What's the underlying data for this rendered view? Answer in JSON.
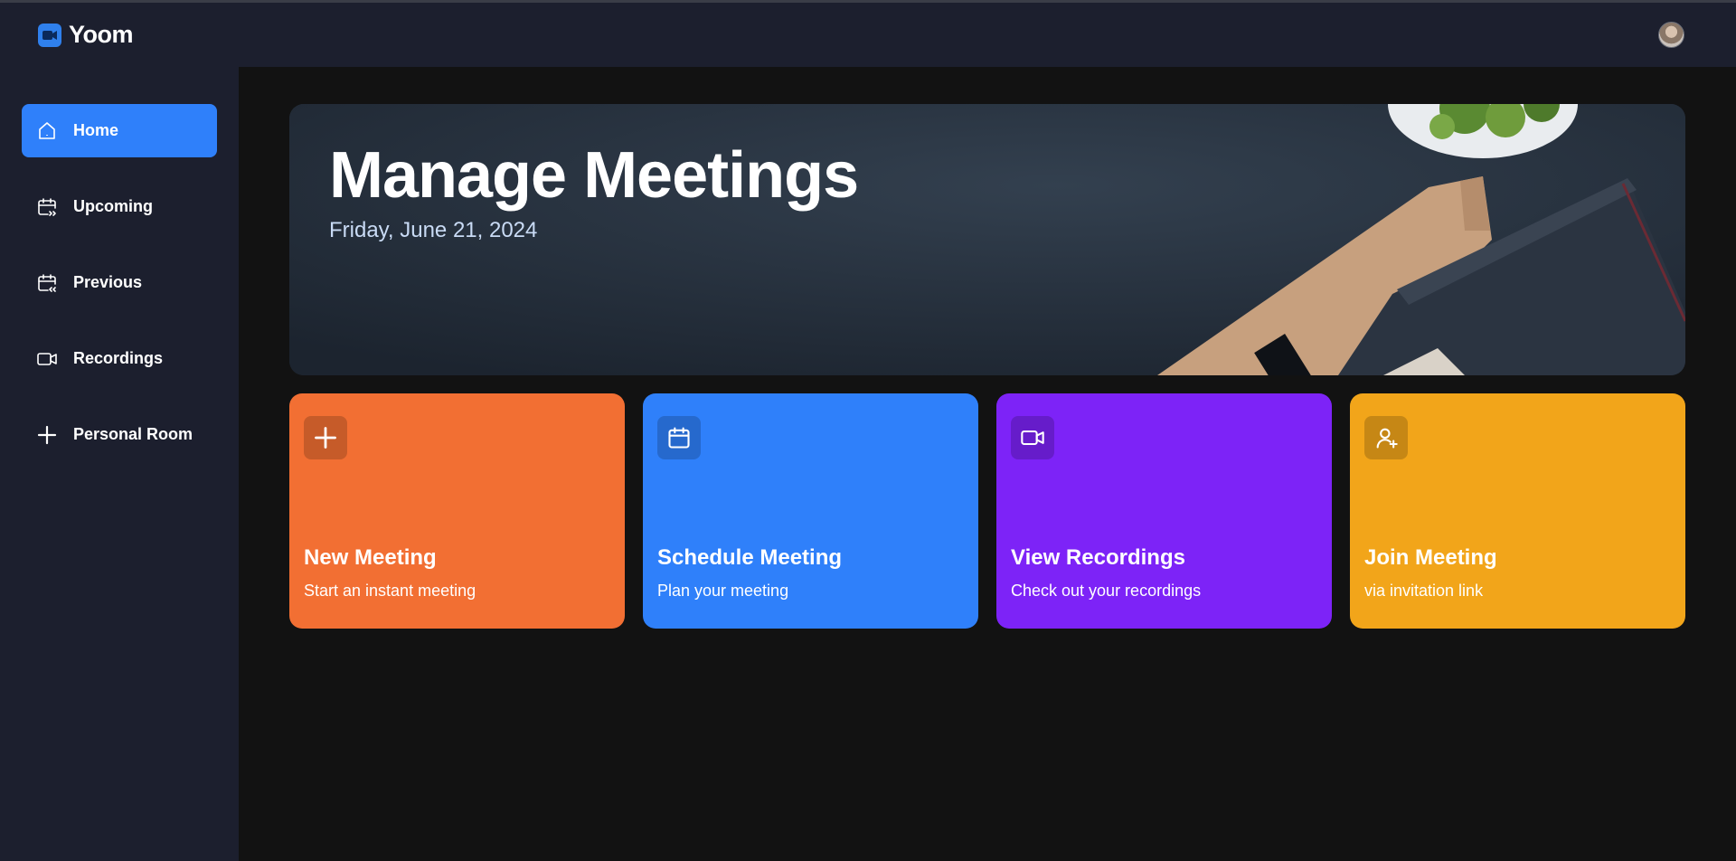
{
  "app": {
    "name": "Yoom"
  },
  "sidebar": {
    "items": [
      {
        "label": "Home",
        "icon": "home-icon",
        "active": true
      },
      {
        "label": "Upcoming",
        "icon": "calendar-upcoming-icon",
        "active": false
      },
      {
        "label": "Previous",
        "icon": "calendar-previous-icon",
        "active": false
      },
      {
        "label": "Recordings",
        "icon": "video-icon",
        "active": false
      },
      {
        "label": "Personal Room",
        "icon": "plus-icon",
        "active": false
      }
    ]
  },
  "hero": {
    "title": "Manage Meetings",
    "date": "Friday, June 21, 2024"
  },
  "cards": [
    {
      "title": "New Meeting",
      "subtitle": "Start an instant meeting",
      "icon": "plus-icon",
      "color": "#f26f33"
    },
    {
      "title": "Schedule Meeting",
      "subtitle": "Plan your meeting",
      "icon": "calendar-icon",
      "color": "#2f80fa"
    },
    {
      "title": "View Recordings",
      "subtitle": "Check out your recordings",
      "icon": "video-icon",
      "color": "#7d23f7"
    },
    {
      "title": "Join Meeting",
      "subtitle": "via invitation link",
      "icon": "add-user-icon",
      "color": "#f2a51a"
    }
  ],
  "colors": {
    "accent": "#2f80fa",
    "sidebar": "#1c1f2e",
    "background": "#121212"
  }
}
